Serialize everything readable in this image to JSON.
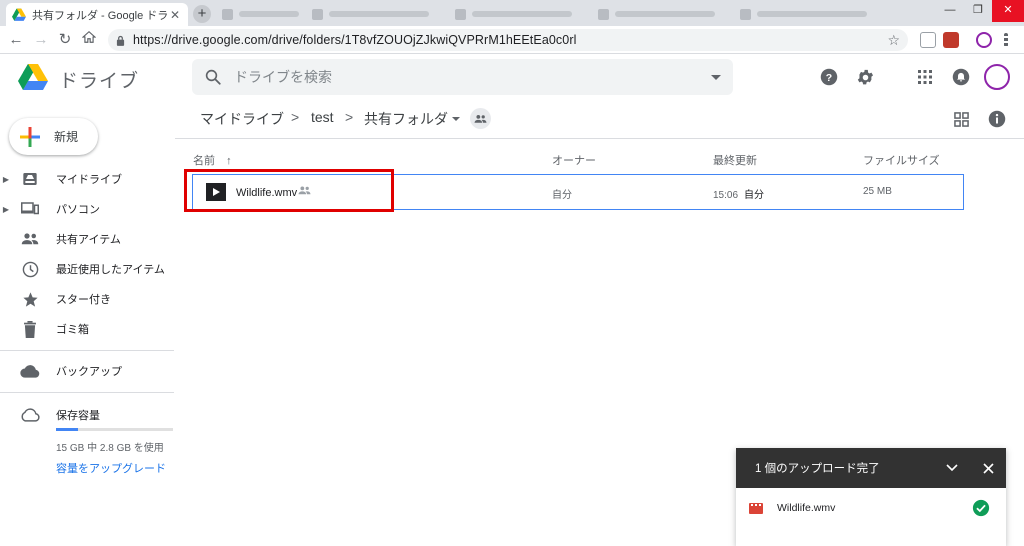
{
  "browser": {
    "tab_title": "共有フォルダ - Google ドライブ",
    "url": "https://drive.google.com/drive/folders/1T8vfZOUOjZJkwiQVPRrM1hEEtEa0c0rl"
  },
  "app": {
    "logo_text": "ドライブ",
    "search_placeholder": "ドライブを検索"
  },
  "sidebar": {
    "new_label": "新規",
    "items": [
      {
        "label": "マイドライブ"
      },
      {
        "label": "パソコン"
      },
      {
        "label": "共有アイテム"
      },
      {
        "label": "最近使用したアイテム"
      },
      {
        "label": "スター付き"
      },
      {
        "label": "ゴミ箱"
      },
      {
        "label": "バックアップ"
      },
      {
        "label": "保存容量"
      }
    ],
    "storage_used_fraction": 0.187,
    "storage_text": "15 GB 中 2.8 GB を使用",
    "upgrade_link": "容量をアップグレード"
  },
  "breadcrumb": {
    "items": [
      "マイドライブ",
      "test",
      "共有フォルダ"
    ],
    "separator": ">"
  },
  "table": {
    "columns": {
      "name": "名前",
      "sort_arrow": "↑",
      "owner": "オーナー",
      "modified": "最終更新",
      "size": "ファイルサイズ"
    },
    "rows": [
      {
        "name": "Wildlife.wmv",
        "owner": "自分",
        "modified_time": "15:06",
        "modified_by": "自分",
        "size": "25 MB"
      }
    ]
  },
  "upload_panel": {
    "title": "1 個のアップロード完了",
    "file": "Wildlife.wmv"
  },
  "colors": {
    "accent_blue": "#4285f4",
    "highlight_red": "#e00000",
    "success_green": "#0f9d58",
    "panel_header": "#323232"
  }
}
